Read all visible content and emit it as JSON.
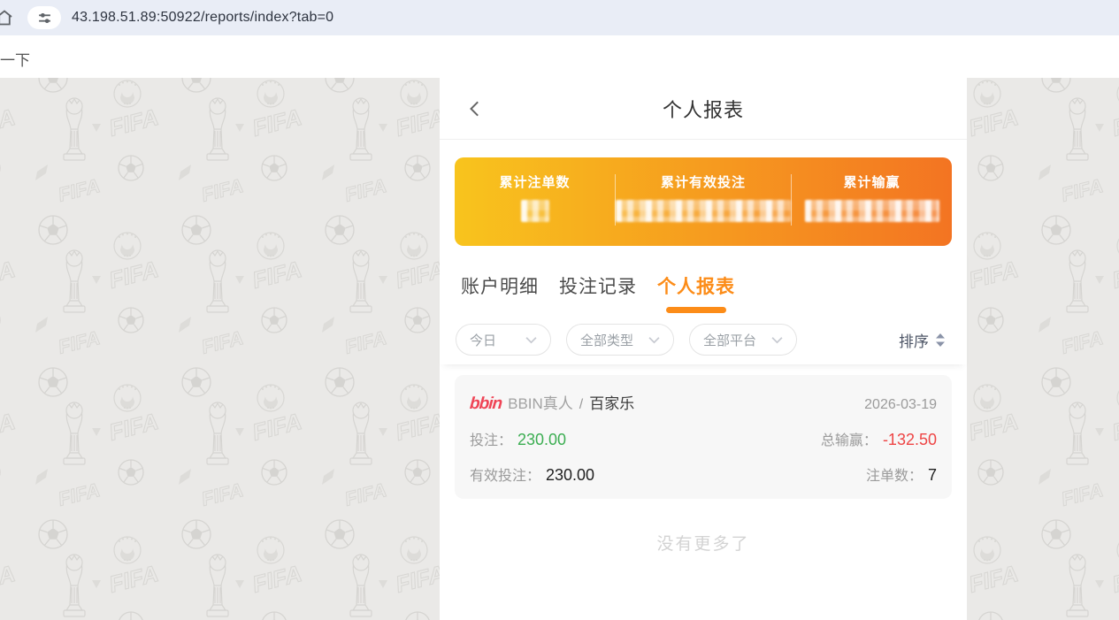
{
  "browser": {
    "url": "43.198.51.89:50922/reports/index?tab=0",
    "icons": {
      "home": "home-icon",
      "site_info": "tune-icon"
    }
  },
  "stray_text": "一下",
  "panel": {
    "header": {
      "title": "个人报表",
      "back_icon": "chevron-left-icon"
    },
    "summary": {
      "items": [
        {
          "label": "累计注单数",
          "value_redacted": true
        },
        {
          "label": "累计有效投注",
          "value_redacted": true
        },
        {
          "label": "累计输赢",
          "value_redacted": true
        }
      ]
    },
    "tabs": [
      {
        "label": "账户明细",
        "active": false
      },
      {
        "label": "投注记录",
        "active": false
      },
      {
        "label": "个人报表",
        "active": true
      }
    ],
    "filters": [
      {
        "label": "今日"
      },
      {
        "label": "全部类型"
      },
      {
        "label": "全部平台"
      }
    ],
    "sort_label": "排序",
    "records": [
      {
        "logo_text": "bbin",
        "provider": "BBIN真人",
        "separator": "/",
        "game": "百家乐",
        "date": "2026-03-19",
        "bet_label": "投注：",
        "bet_value": "230.00",
        "winloss_label": "总输赢：",
        "winloss_value": "-132.50",
        "valid_bet_label": "有效投注：",
        "valid_bet_value": "230.00",
        "count_label": "注单数：",
        "count_value": "7"
      }
    ],
    "no_more_text": "没有更多了"
  },
  "colors": {
    "accent_orange": "#fc8c18",
    "card_gradient_start": "#f8c41d",
    "card_gradient_end": "#f37422",
    "positive_green": "#3cae52",
    "negative_red": "#ee4545",
    "logo_red": "#ef4456",
    "browser_bar": "#e9edf6",
    "watermark_bg": "#eae9e7"
  }
}
